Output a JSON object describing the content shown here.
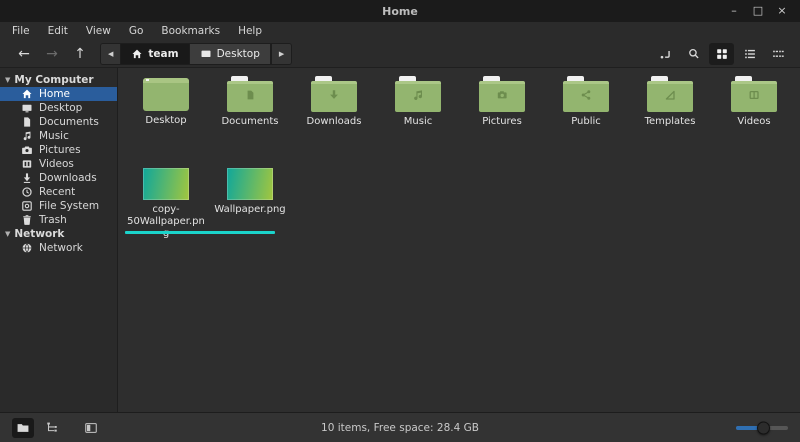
{
  "window": {
    "title": "Home"
  },
  "titlebar_controls": {
    "minimize": "–",
    "maximize": "□",
    "close": "×"
  },
  "menubar": {
    "items": [
      "File",
      "Edit",
      "View",
      "Go",
      "Bookmarks",
      "Help"
    ]
  },
  "toolbar": {
    "nav": {
      "back": "←",
      "forward": "→",
      "up": "↑"
    },
    "breadcrumb": {
      "prev": "◀",
      "next": "▶",
      "segments": [
        {
          "label": "team",
          "icon": "home-icon"
        },
        {
          "label": "Desktop",
          "icon": "desktop-icon"
        }
      ]
    },
    "right_icons": [
      "location-entry-icon",
      "search-icon",
      "grid-view-icon",
      "list-view-icon",
      "compact-view-icon"
    ],
    "active_view": "grid"
  },
  "sidebar": {
    "sections": [
      {
        "label": "My Computer",
        "items": [
          {
            "label": "Home",
            "icon": "home-icon",
            "selected": true
          },
          {
            "label": "Desktop",
            "icon": "desktop-icon"
          },
          {
            "label": "Documents",
            "icon": "document-icon"
          },
          {
            "label": "Music",
            "icon": "music-note-icon"
          },
          {
            "label": "Pictures",
            "icon": "camera-icon"
          },
          {
            "label": "Videos",
            "icon": "film-icon"
          },
          {
            "label": "Downloads",
            "icon": "down-arrow-icon"
          },
          {
            "label": "Recent",
            "icon": "clock-icon"
          },
          {
            "label": "File System",
            "icon": "disk-icon"
          },
          {
            "label": "Trash",
            "icon": "trash-icon"
          }
        ]
      },
      {
        "label": "Network",
        "items": [
          {
            "label": "Network",
            "icon": "globe-icon"
          }
        ]
      }
    ]
  },
  "content": {
    "folders": [
      {
        "label": "Desktop",
        "emblem": "none"
      },
      {
        "label": "Documents",
        "emblem": "document"
      },
      {
        "label": "Downloads",
        "emblem": "down-arrow"
      },
      {
        "label": "Music",
        "emblem": "music-note"
      },
      {
        "label": "Pictures",
        "emblem": "camera"
      },
      {
        "label": "Public",
        "emblem": "share"
      },
      {
        "label": "Templates",
        "emblem": "set-square"
      },
      {
        "label": "Videos",
        "emblem": "film"
      }
    ],
    "files": [
      {
        "label": "copy-50Wallpaper.png",
        "type": "image"
      },
      {
        "label": "Wallpaper.png",
        "type": "image"
      }
    ]
  },
  "statusbar": {
    "text": "10 items, Free space: 28.4 GB"
  },
  "colors": {
    "selection_blue": "#2a5d9c",
    "folder_green": "#93b56f",
    "divider_cyan": "#1bd4cb",
    "slider_blue": "#2f6fb2",
    "thumbnail_gradient": [
      "#0fa79b",
      "#a3c63e"
    ]
  }
}
